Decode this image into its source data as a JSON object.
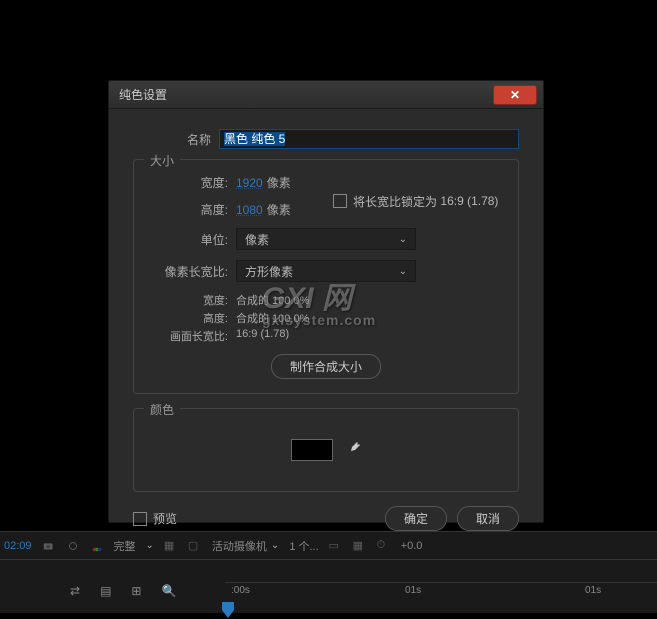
{
  "dialog": {
    "title": "纯色设置",
    "name_label": "名称",
    "name_value": "黑色 纯色 5",
    "size_section": "大小",
    "width_label": "宽度:",
    "width_value": "1920",
    "width_unit": "像素",
    "height_label": "高度:",
    "height_value": "1080",
    "height_unit": "像素",
    "lock_aspect_label": "将长宽比锁定为",
    "lock_aspect_value": "16:9 (1.78)",
    "unit_label": "单位:",
    "unit_value": "像素",
    "par_label": "像素长宽比:",
    "par_value": "方形像素",
    "info_width_label": "宽度:",
    "info_width_value": "合成的 100.0%",
    "info_height_label": "高度:",
    "info_height_value": "合成的 100.0%",
    "frame_aspect_label": "画面长宽比:",
    "frame_aspect_value": "16:9 (1.78)",
    "make_comp_btn": "制作合成大小",
    "color_section": "颜色",
    "preview_label": "预览",
    "ok_label": "确定",
    "cancel_label": "取消"
  },
  "toolbar": {
    "timecode": "02:09",
    "zoom": "完整",
    "camera": "活动摄像机",
    "view": "1 个...",
    "trail": "+0.0"
  },
  "timeline": {
    "marks": [
      ":00s",
      "01s",
      "01s"
    ]
  },
  "watermark": {
    "main": "GXI 网",
    "sub": "gxlsystem.com"
  }
}
